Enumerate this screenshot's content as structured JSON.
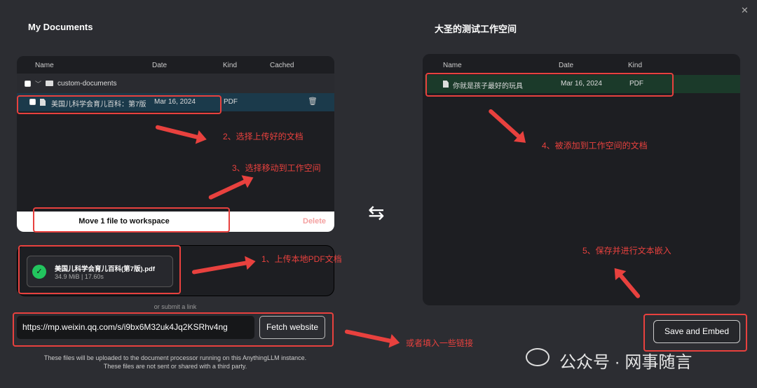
{
  "left": {
    "title": "My Documents",
    "columns": [
      "Name",
      "Date",
      "Kind",
      "Cached"
    ],
    "folder": "custom-documents",
    "file": {
      "name": "美国儿科学会育儿百科：第7版",
      "date": "Mar 16, 2024",
      "kind": "PDF"
    },
    "move_button": "Move 1 file to workspace",
    "delete_button": "Delete"
  },
  "upload": {
    "file_name": "美国儿科学会育儿百科(第7版).pdf",
    "file_meta": "34.9 MiB | 17.60s",
    "or_link": "or submit a link",
    "url_value": "https://mp.weixin.qq.com/s/i9bx6M32uk4Jq2KSRhv4ng",
    "fetch_button": "Fetch website",
    "disclaimer_1": "These files will be uploaded to the document processor running on this AnythingLLM instance.",
    "disclaimer_2": "These files are not sent or shared with a third party."
  },
  "right": {
    "title": "大圣的测试工作空间",
    "columns": [
      "Name",
      "Date",
      "Kind"
    ],
    "file": {
      "name": "你就是孩子最好的玩具",
      "date": "Mar 16, 2024",
      "kind": "PDF"
    },
    "save_button": "Save and Embed"
  },
  "swap_icon": "⇆",
  "close_icon": "✕",
  "annotations": {
    "a1": "1、上传本地PDF文档",
    "a2": "2、选择上传好的文档",
    "a3": "3、选择移动到工作空间",
    "a4": "4、被添加到工作空间的文档",
    "a5": "5、保存并进行文本嵌入",
    "a6": "或者填入一些链接"
  },
  "watermark": "公众号 · 网事随言",
  "colors": {
    "annotation": "#e8413e",
    "selected_row": "#1b3a4b",
    "workspace_row": "#1b3a2a",
    "success": "#22c55e"
  }
}
